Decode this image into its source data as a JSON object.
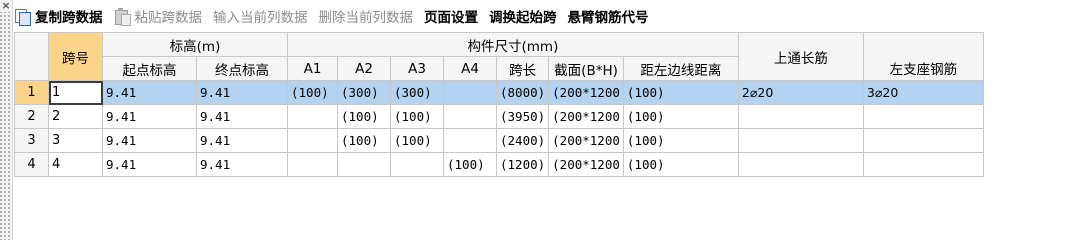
{
  "window": {
    "close_glyph": "×"
  },
  "toolbar": {
    "copy_label": "复制跨数据",
    "paste_label": "粘贴跨数据",
    "input_col_label": "输入当前列数据",
    "delete_col_label": "删除当前列数据",
    "page_setup_label": "页面设置",
    "swap_start_label": "调换起始跨",
    "cantilever_code_label": "悬臂钢筋代号"
  },
  "grid": {
    "headers": {
      "span_no": "跨号",
      "elevation": "标高(m)",
      "start_elev": "起点标高",
      "end_elev": "终点标高",
      "member_size": "构件尺寸(mm)",
      "a1": "A1",
      "a2": "A2",
      "a3": "A3",
      "a4": "A4",
      "span_len": "跨长",
      "section": "截面(B*H)",
      "dist_left": "距左边线距离",
      "top_through": "上通长筋",
      "left_support": "左支座钢筋"
    },
    "rows": [
      {
        "rownum": "1",
        "span": "1",
        "start": "9.41",
        "end": "9.41",
        "a1": "(100)",
        "a2": "(300)",
        "a3": "(300)",
        "a4": "",
        "len": "(8000)",
        "section": "(200*1200",
        "dist": "(100)",
        "top": "2⌀20",
        "left": "3⌀20"
      },
      {
        "rownum": "2",
        "span": "2",
        "start": "9.41",
        "end": "9.41",
        "a1": "",
        "a2": "(100)",
        "a3": "(100)",
        "a4": "",
        "len": "(3950)",
        "section": "(200*1200",
        "dist": "(100)",
        "top": "",
        "left": ""
      },
      {
        "rownum": "3",
        "span": "3",
        "start": "9.41",
        "end": "9.41",
        "a1": "",
        "a2": "(100)",
        "a3": "(100)",
        "a4": "",
        "len": "(2400)",
        "section": "(200*1200",
        "dist": "(100)",
        "top": "",
        "left": ""
      },
      {
        "rownum": "4",
        "span": "4",
        "start": "9.41",
        "end": "9.41",
        "a1": "",
        "a2": "",
        "a3": "",
        "a4": "(100)",
        "len": "(1200)",
        "section": "(200*1200",
        "dist": "(100)",
        "top": "",
        "left": ""
      }
    ]
  },
  "colors": {
    "selected_row": "#b4d3f1",
    "header_highlight": "#fbd48a"
  }
}
